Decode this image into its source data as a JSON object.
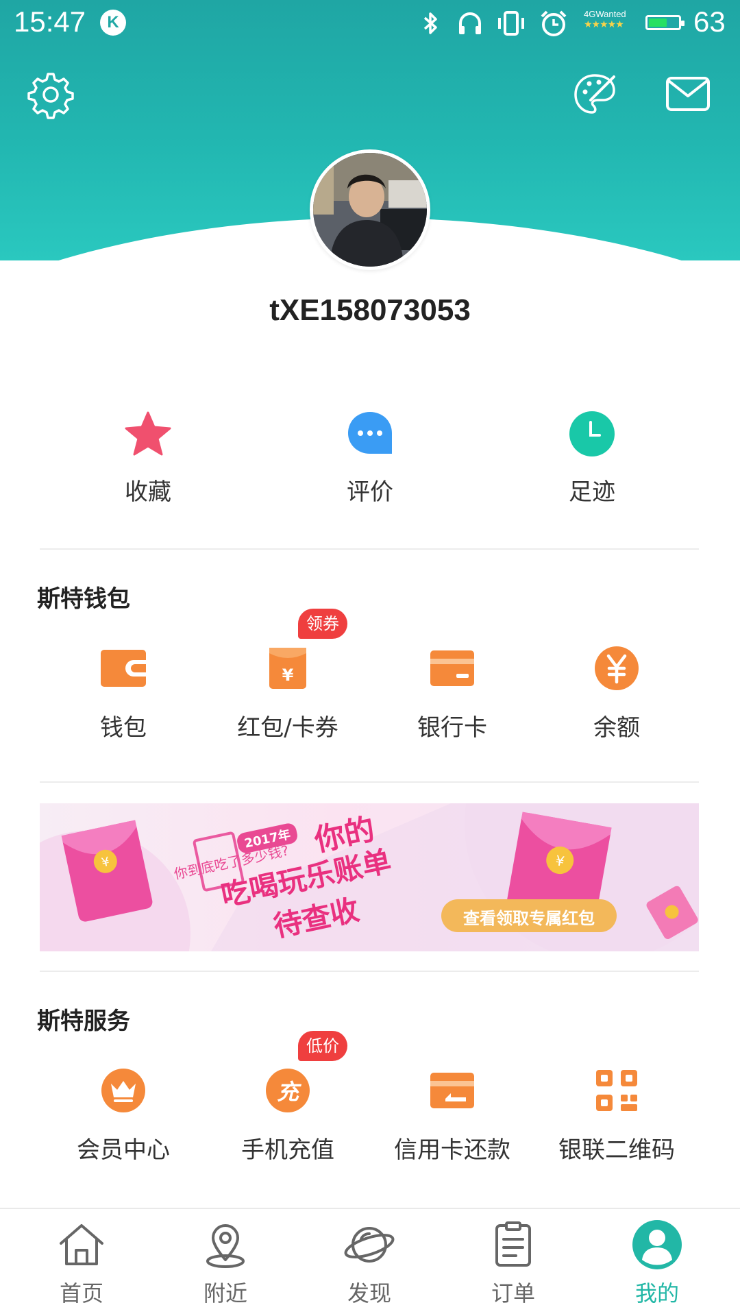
{
  "status_bar": {
    "time": "15:47",
    "k_badge": "K",
    "network_label": "4GWanted",
    "network_stars": "★★★★★",
    "battery_percent": "63",
    "battery_level": 0.63,
    "icons": [
      "bluetooth-icon",
      "headphones-icon",
      "vibrate-icon",
      "alarm-icon"
    ]
  },
  "header": {
    "icons": [
      "gear-icon",
      "paint-palette-icon",
      "mail-icon"
    ]
  },
  "profile": {
    "username": "tXE158073053"
  },
  "quick_actions": [
    {
      "label": "收藏",
      "icon": "star-icon",
      "color": "#f0506e"
    },
    {
      "label": "评价",
      "icon": "chat-bubble-icon",
      "color": "#3a9cf4"
    },
    {
      "label": "足迹",
      "icon": "clock-icon",
      "color": "#19c8a8"
    }
  ],
  "wallet": {
    "title": "斯特钱包",
    "items": [
      {
        "label": "钱包",
        "icon": "wallet-icon",
        "badge": ""
      },
      {
        "label": "红包/卡券",
        "icon": "red-envelope-icon",
        "badge": "领券"
      },
      {
        "label": "银行卡",
        "icon": "bank-card-icon",
        "badge": ""
      },
      {
        "label": "余额",
        "icon": "yuan-coin-icon",
        "badge": ""
      }
    ]
  },
  "banner": {
    "year_tag": "2017年",
    "line1": "你到底吃了多少钱?",
    "headline1": "你的",
    "headline2": "吃喝玩乐账单",
    "headline3": "待查收",
    "cta": "查看领取专属红包"
  },
  "services": {
    "title": "斯特服务",
    "items": [
      {
        "label": "会员中心",
        "icon": "crown-icon",
        "badge": ""
      },
      {
        "label": "手机充值",
        "icon": "recharge-icon",
        "badge": "低价",
        "glyph": "充"
      },
      {
        "label": "信用卡还款",
        "icon": "credit-card-icon",
        "badge": ""
      },
      {
        "label": "银联二维码",
        "icon": "qr-code-icon",
        "badge": ""
      }
    ]
  },
  "bottom_nav": [
    {
      "label": "首页",
      "icon": "home-icon",
      "active": false
    },
    {
      "label": "附近",
      "icon": "location-pin-icon",
      "active": false
    },
    {
      "label": "发现",
      "icon": "planet-icon",
      "active": false
    },
    {
      "label": "订单",
      "icon": "clipboard-icon",
      "active": false
    },
    {
      "label": "我的",
      "icon": "user-icon",
      "active": true
    }
  ],
  "colors": {
    "accent": "#22b7a6",
    "header_top": "#1fa6a4",
    "header_bottom": "#2ac8bf",
    "orange": "#f5893a",
    "badge_red": "#ef3f3f"
  }
}
